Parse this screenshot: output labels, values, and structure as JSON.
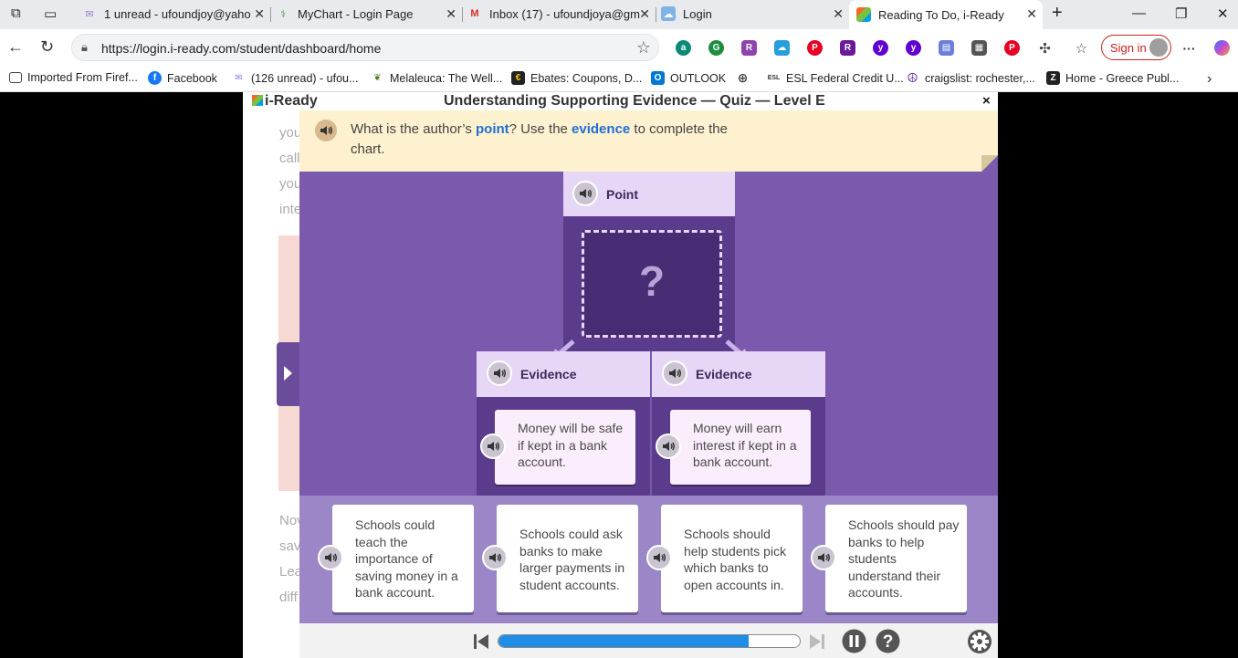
{
  "browser": {
    "tabs": [
      {
        "title": "1 unread - ufoundjoy@yaho",
        "icon": "mail-icon"
      },
      {
        "title": "MyChart - Login Page",
        "icon": "mychart-icon"
      },
      {
        "title": "Inbox (17) - ufoundjoya@gm",
        "icon": "gmail-icon"
      },
      {
        "title": "Login",
        "icon": "cloud-icon"
      },
      {
        "title": "Reading To Do, i-Ready",
        "icon": "iready-icon",
        "active": true
      }
    ],
    "url": "https://login.i-ready.com/student/dashboard/home",
    "sign_in": "Sign in",
    "bookmarks": [
      "Imported From Firef...",
      "Facebook",
      "(126 unread) - ufou...",
      "Melaleuca: The Well...",
      "Ebates: Coupons, D...",
      "OUTLOOK",
      "ESL Federal Credit U...",
      "craigslist: rochester,...",
      "Home - Greece Publ..."
    ]
  },
  "article": {
    "lines_top": [
      "you",
      "call",
      "you",
      "inte"
    ],
    "lines_bottom": [
      "Nov",
      "sav",
      "Lea",
      "diff"
    ]
  },
  "quiz": {
    "logo": "i-Ready",
    "title": "Understanding Supporting Evidence — Quiz — Level E",
    "close": "×",
    "prompt": {
      "part1": "What is the author’s ",
      "hl1": "point",
      "part2": "? Use the ",
      "hl2": "evidence",
      "part3": " to complete the chart."
    },
    "point_label": "Point",
    "drop_placeholder": "?",
    "evidence": [
      {
        "label": "Evidence",
        "text": "Money will be safe if kept in a bank account."
      },
      {
        "label": "Evidence",
        "text": "Money will earn interest if kept in a bank account."
      }
    ],
    "answers": [
      "Schools could teach the importance of saving money in a bank account.",
      "Schools could ask banks to make larger payments in student accounts.",
      "Schools should help students pick which banks to open accounts in.",
      "Schools should pay banks to help students understand their accounts."
    ],
    "progress": 0.83
  },
  "colors": {
    "quiz_bg": "#7b5aad",
    "prompt_bg": "#fdf1d0",
    "highlight": "#1f6fd1",
    "progress_fill": "#1f8ce6"
  }
}
